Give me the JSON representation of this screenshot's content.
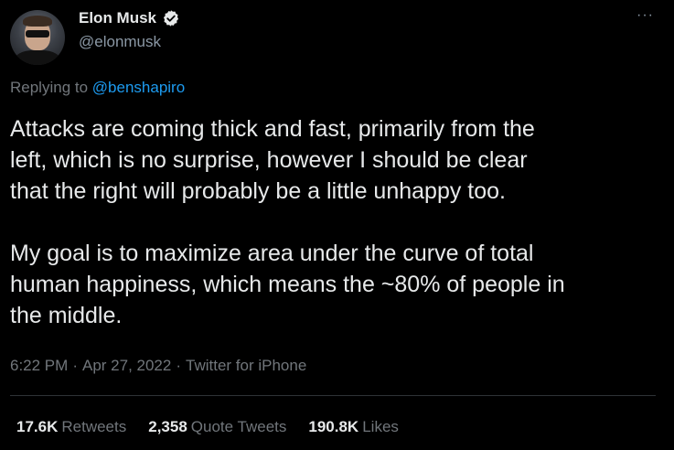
{
  "author": {
    "display_name": "Elon Musk",
    "handle": "@elonmusk",
    "verified": true
  },
  "reply": {
    "prefix": "Replying to",
    "mention": "@benshapiro"
  },
  "tweet": {
    "text": "Attacks are coming thick and fast, primarily from the\nleft, which is no surprise, however I should be clear\nthat the right will probably be a little unhappy too.\n\nMy goal is to maximize area under the curve of total\nhuman happiness, which means the ~80% of people in\nthe middle."
  },
  "meta": {
    "time": "6:22 PM",
    "date": "Apr 27, 2022",
    "source": "Twitter for iPhone",
    "separator": "·"
  },
  "stats": {
    "retweets_count": "17.6K",
    "retweets_label": "Retweets",
    "quotes_count": "2,358",
    "quotes_label": "Quote Tweets",
    "likes_count": "190.8K",
    "likes_label": "Likes"
  },
  "menu": {
    "more_label": "···"
  },
  "colors": {
    "background": "#000000",
    "text": "#e7e9ea",
    "secondary": "#71767b",
    "accent": "#1d9bf0",
    "divider": "#2f3336"
  }
}
